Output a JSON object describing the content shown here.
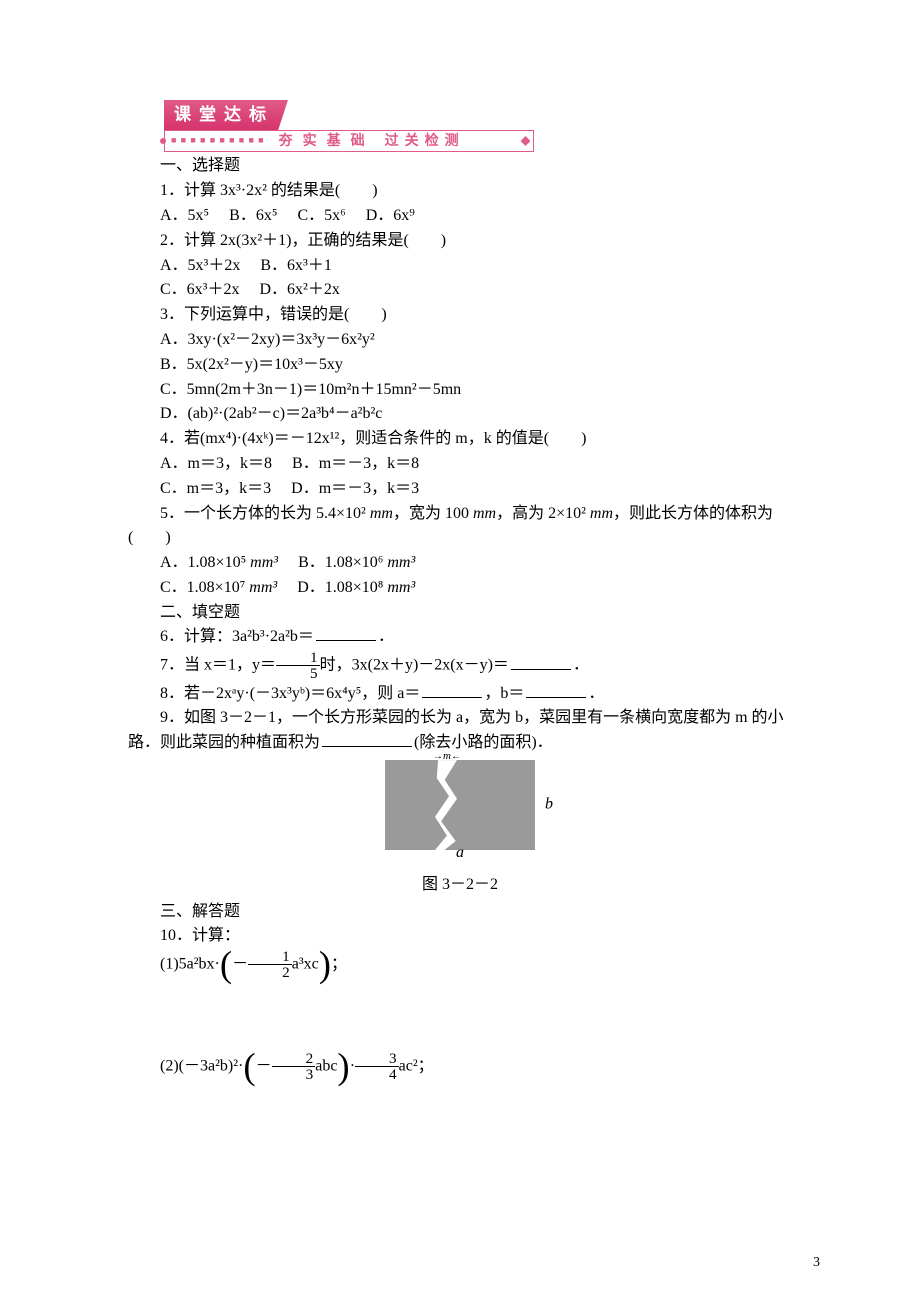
{
  "banner": {
    "title": "课堂达标",
    "sub1": "夯实基础",
    "sub2": "过关检测"
  },
  "sec1": {
    "title": "一、选择题",
    "q1": {
      "stem": "1．计算 3x³·2x² 的结果是(　　)",
      "a": "A．5x⁵",
      "b": "B．6x⁵",
      "c": "C．5x⁶",
      "d": "D．6x⁹"
    },
    "q2": {
      "stem": "2．计算 2x(3x²＋1)，正确的结果是(　　)",
      "a": "A．5x³＋2x",
      "b": "B．6x³＋1",
      "c": "C．6x³＋2x",
      "d": "D．6x²＋2x"
    },
    "q3": {
      "stem": "3．下列运算中，错误的是(　　)",
      "a": "A．3xy·(x²－2xy)＝3x³y－6x²y²",
      "b": "B．5x(2x²－y)＝10x³－5xy",
      "c": "C．5mn(2m＋3n－1)＝10m²n＋15mn²－5mn",
      "d": "D．(ab)²·(2ab²－c)＝2a³b⁴－a²b²c"
    },
    "q4": {
      "stem": "4．若(mx⁴)·(4xᵏ)＝－12x¹²，则适合条件的 m，k 的值是(　　)",
      "a": "A．m＝3，k＝8",
      "b": "B．m＝－3，k＝8",
      "c": "C．m＝3，k＝3",
      "d": "D．m＝－3，k＝3"
    },
    "q5": {
      "stem_pre": "5．一个长方体的长为 5.4×10² ",
      "unit": "mm",
      "stem_mid1": "，宽为 100 ",
      "stem_mid2": "，高为 2×10² ",
      "stem_post": "，则此长方体的体积为",
      "tail": "(　　)",
      "a_pre": "A．1.08×10⁵ ",
      "b_pre": "B．1.08×10⁶ ",
      "c_pre": "C．1.08×10⁷ ",
      "d_pre": "D．1.08×10⁸ ",
      "unit3": "mm³"
    }
  },
  "sec2": {
    "title": "二、填空题",
    "q6": "6．计算：3a²b³·2a²b＝",
    "q6_tail": "．",
    "q7_pre": "7．当 x＝1，y＝",
    "q7_frac_num": "1",
    "q7_frac_den": "5",
    "q7_mid": "时，3x(2x＋y)－2x(x－y)＝",
    "q7_tail": "．",
    "q8_pre": "8．若－2xᵃy·(－3x³yᵇ)＝6x⁴y⁵，则 a＝",
    "q8_mid": "，b＝",
    "q8_tail": "．",
    "q9_l1": "9．如图 3－2－1，一个长方形菜园的长为 a，宽为 b，菜园里有一条横向宽度都为 m 的小",
    "q9_l2_pre": "路．则此菜园的种植面积为",
    "q9_l2_post": "(除去小路的面积)．"
  },
  "figure": {
    "m": "m",
    "a": "a",
    "b": "b",
    "caption": "图 3－2－2"
  },
  "sec3": {
    "title": "三、解答题",
    "q10": "10．计算：",
    "q10_1_pre": "(1)5a²bx·",
    "q10_1_num": "1",
    "q10_1_den": "2",
    "q10_1_mid": "a³xc",
    "q10_1_tail": "；",
    "q10_2_pre": "(2)(－3a²b)²·",
    "q10_2a_num": "2",
    "q10_2a_den": "3",
    "q10_2a_mid": "abc",
    "q10_2b_dot": "·",
    "q10_2b_num": "3",
    "q10_2b_den": "4",
    "q10_2b_mid": "ac²",
    "q10_2_tail": "；"
  },
  "page_num": "3"
}
